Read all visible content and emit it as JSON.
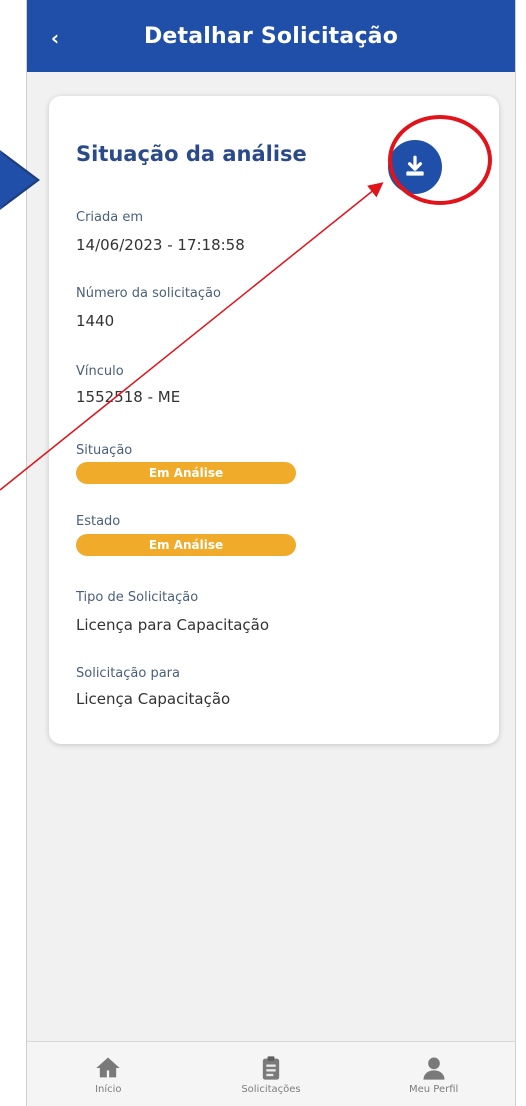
{
  "header": {
    "title": "Detalhar Solicitação",
    "back_icon": "chevron-left-icon"
  },
  "card": {
    "title": "Situação da análise",
    "download_icon": "download-icon",
    "fields": [
      {
        "label": "Criada em",
        "value": "14/06/2023 - 17:18:58"
      },
      {
        "label": "Número da solicitação",
        "value": "1440"
      },
      {
        "label": "Vínculo",
        "value": "1552518 - ME"
      }
    ],
    "situacao": {
      "label": "Situação",
      "badge": "Em Análise"
    },
    "estado": {
      "label": "Estado",
      "badge": "Em Análise"
    },
    "tipo": {
      "label": "Tipo de Solicitação",
      "value": "Licença para Capacitação"
    },
    "para": {
      "label": "Solicitação para",
      "value": "Licença Capacitação"
    }
  },
  "bottom_nav": [
    {
      "label": "Início",
      "icon": "home-icon"
    },
    {
      "label": "Solicitações",
      "icon": "clipboard-icon"
    },
    {
      "label": "Meu Perfil",
      "icon": "user-icon"
    }
  ],
  "colors": {
    "primary": "#1f4fa8",
    "badge": "#f0ab2a",
    "annotation": "#e1131b"
  }
}
